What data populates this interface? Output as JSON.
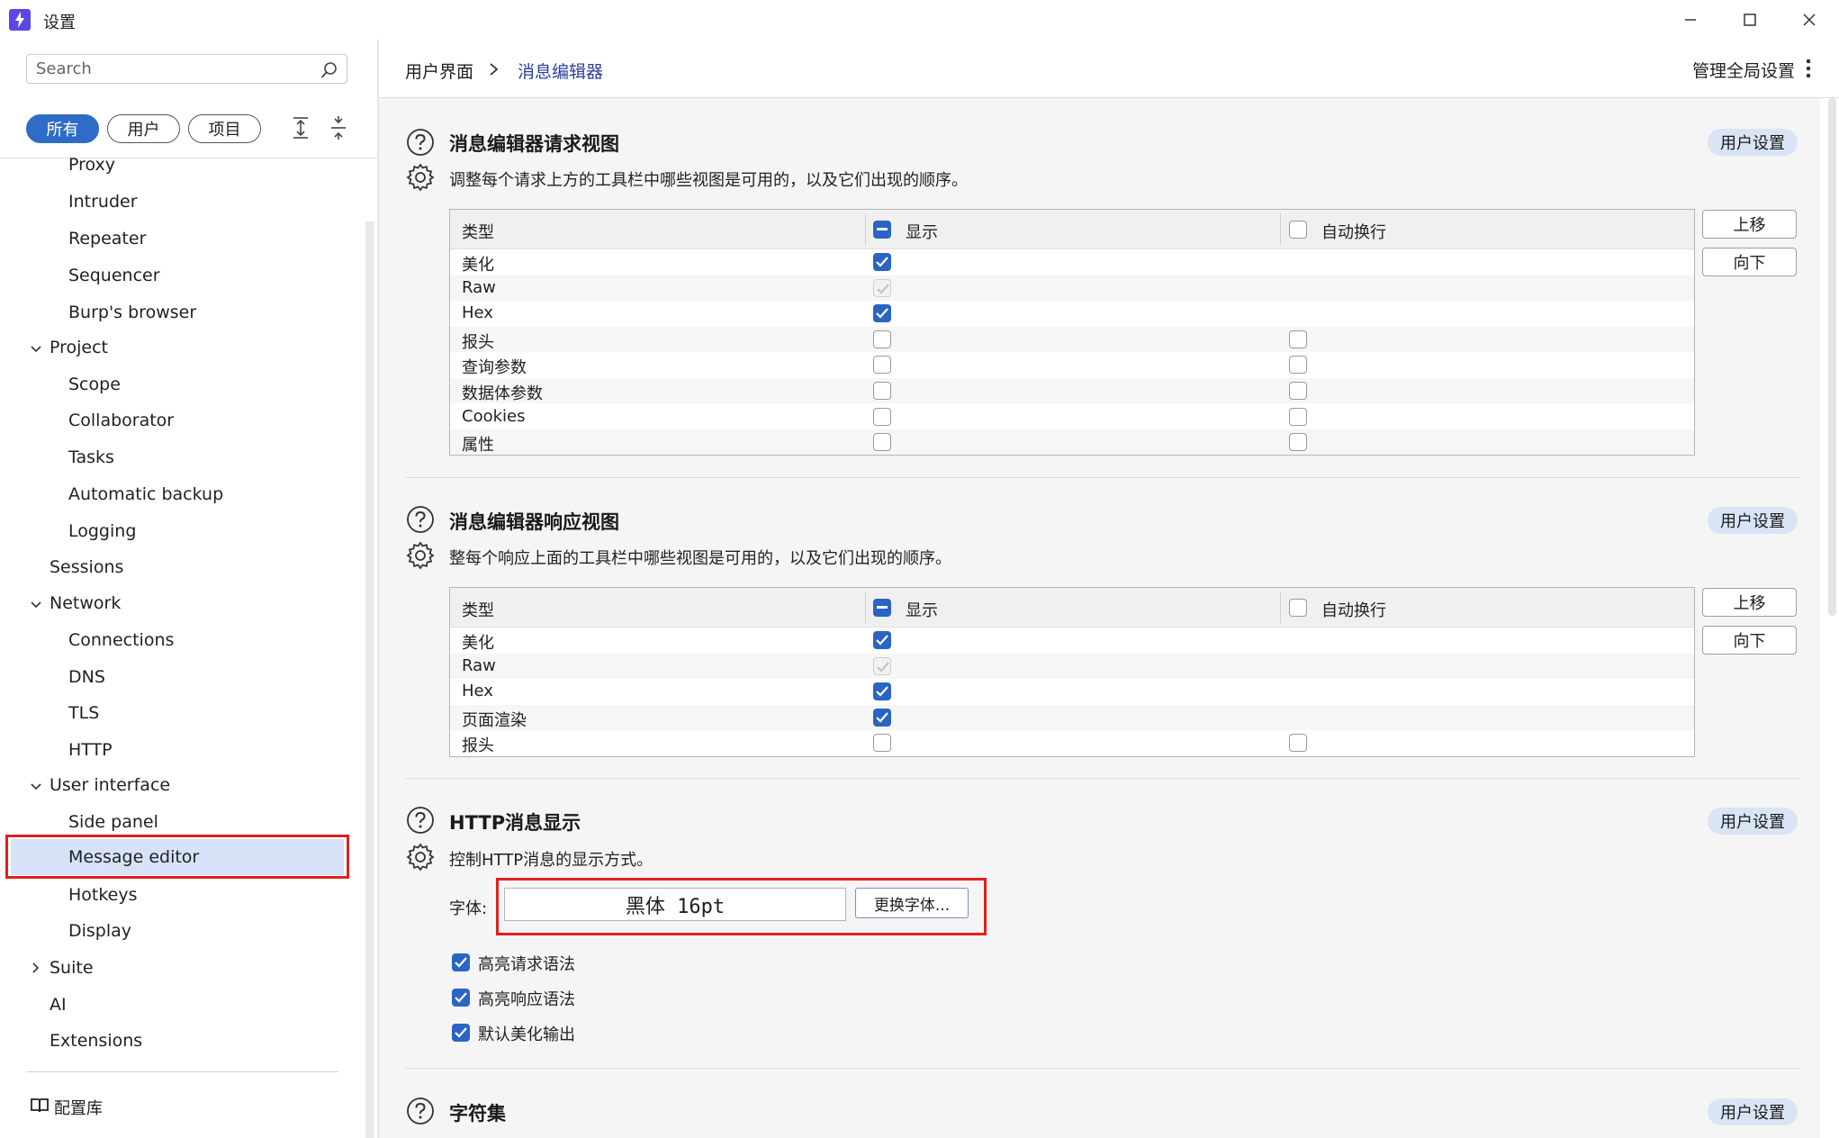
{
  "window": {
    "title": "设置"
  },
  "sidebar": {
    "search_placeholder": "Search",
    "filters": [
      "所有",
      "用户",
      "项目"
    ],
    "items": [
      {
        "label": "Proxy"
      },
      {
        "label": "Intruder"
      },
      {
        "label": "Repeater"
      },
      {
        "label": "Sequencer"
      },
      {
        "label": "Burp's browser"
      },
      {
        "label": "Project"
      },
      {
        "label": "Scope"
      },
      {
        "label": "Collaborator"
      },
      {
        "label": "Tasks"
      },
      {
        "label": "Automatic backup"
      },
      {
        "label": "Logging"
      },
      {
        "label": "Sessions"
      },
      {
        "label": "Network"
      },
      {
        "label": "Connections"
      },
      {
        "label": "DNS"
      },
      {
        "label": "TLS"
      },
      {
        "label": "HTTP"
      },
      {
        "label": "User interface"
      },
      {
        "label": "Side panel"
      },
      {
        "label": "Message editor"
      },
      {
        "label": "Hotkeys"
      },
      {
        "label": "Display"
      },
      {
        "label": "Suite"
      },
      {
        "label": "AI"
      },
      {
        "label": "Extensions"
      }
    ],
    "library_label": "配置库"
  },
  "header": {
    "breadcrumb_parent": "用户界面",
    "breadcrumb_current": "消息编辑器",
    "manage_global": "管理全局设置"
  },
  "sections": {
    "request_view": {
      "title": "消息编辑器请求视图",
      "description": "调整每个请求上方的工具栏中哪些视图是可用的，以及它们出现的顺序。",
      "user_settings": "用户设置",
      "columns": [
        "类型",
        "显示",
        "自动换行"
      ],
      "rows": [
        {
          "type": "美化",
          "show": "on",
          "wrap": "none"
        },
        {
          "type": "Raw",
          "show": "disabled",
          "wrap": "none"
        },
        {
          "type": "Hex",
          "show": "on",
          "wrap": "none"
        },
        {
          "type": "报头",
          "show": "off",
          "wrap": "off"
        },
        {
          "type": "查询参数",
          "show": "off",
          "wrap": "off"
        },
        {
          "type": "数据体参数",
          "show": "off",
          "wrap": "off"
        },
        {
          "type": "Cookies",
          "show": "off",
          "wrap": "off"
        },
        {
          "type": "属性",
          "show": "off",
          "wrap": "off"
        }
      ],
      "move_up": "上移",
      "move_down": "向下"
    },
    "response_view": {
      "title": "消息编辑器响应视图",
      "description": "整每个响应上面的工具栏中哪些视图是可用的，以及它们出现的顺序。",
      "user_settings": "用户设置",
      "columns": [
        "类型",
        "显示",
        "自动换行"
      ],
      "rows": [
        {
          "type": "美化",
          "show": "on",
          "wrap": "none"
        },
        {
          "type": "Raw",
          "show": "disabled",
          "wrap": "none"
        },
        {
          "type": "Hex",
          "show": "on",
          "wrap": "none"
        },
        {
          "type": "页面渲染",
          "show": "on",
          "wrap": "none"
        },
        {
          "type": "报头",
          "show": "off",
          "wrap": "off"
        }
      ],
      "move_up": "上移",
      "move_down": "向下"
    },
    "http_display": {
      "title": "HTTP消息显示",
      "description": "控制HTTP消息的显示方式。",
      "user_settings": "用户设置",
      "font_label": "字体:",
      "font_value": "黑体 16pt",
      "change_font": "更换字体...",
      "options": [
        {
          "label": "高亮请求语法",
          "checked": true
        },
        {
          "label": "高亮响应语法",
          "checked": true
        },
        {
          "label": "默认美化输出",
          "checked": true
        }
      ]
    },
    "charset": {
      "title": "字符集",
      "user_settings": "用户设置"
    }
  },
  "colors": {
    "accent": "#2a64c4",
    "highlight_box": "#e02020",
    "selected_bg": "#d6e2f7",
    "pill_bg": "#d9e5f5",
    "breadcrumb_active": "#2b3f9e"
  }
}
